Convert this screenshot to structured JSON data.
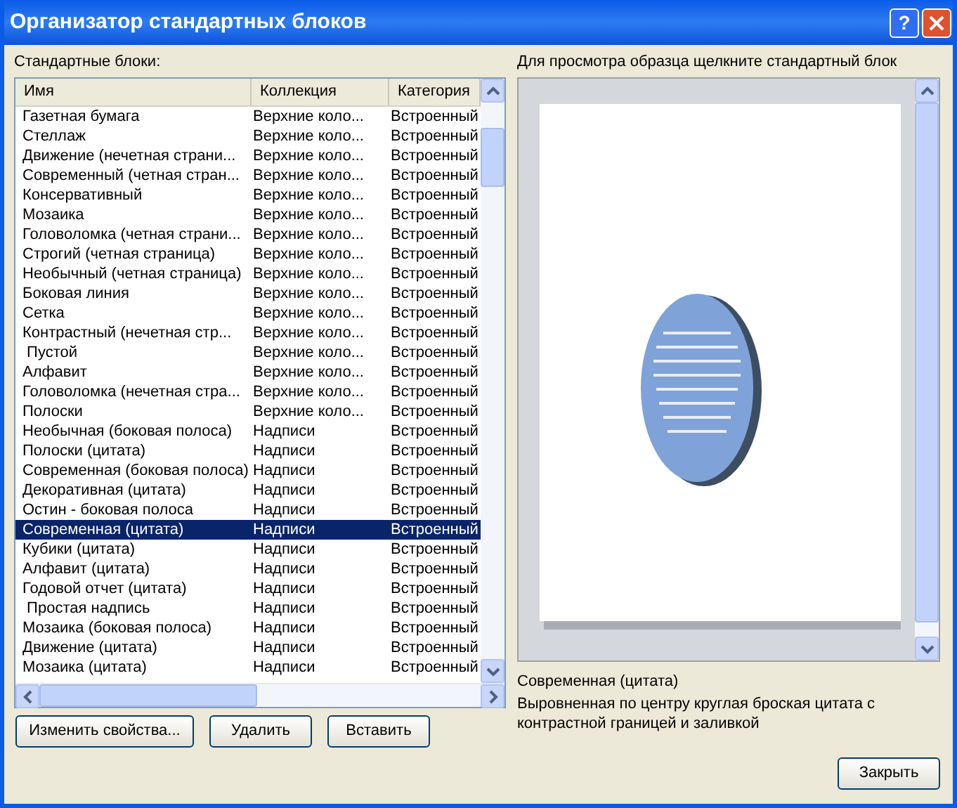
{
  "window": {
    "title": "Организатор стандартных блоков",
    "help_button": "?"
  },
  "list_label": "Стандартные блоки:",
  "table": {
    "columns": [
      "Имя",
      "Коллекция",
      "Категория"
    ],
    "rows": [
      {
        "cells": [
          "Газетная бумага",
          "Верхние коло...",
          "Встроенный"
        ],
        "selected": false
      },
      {
        "cells": [
          "Стеллаж",
          "Верхние коло...",
          "Встроенный"
        ],
        "selected": false
      },
      {
        "cells": [
          "Движение (нечетная страни...",
          "Верхние коло...",
          "Встроенный"
        ],
        "selected": false
      },
      {
        "cells": [
          "Современный (четная стран...",
          "Верхние коло...",
          "Встроенный"
        ],
        "selected": false
      },
      {
        "cells": [
          "Консервативный",
          "Верхние коло...",
          "Встроенный"
        ],
        "selected": false
      },
      {
        "cells": [
          "Мозаика",
          "Верхние коло...",
          "Встроенный"
        ],
        "selected": false
      },
      {
        "cells": [
          "Головоломка (четная страни...",
          "Верхние коло...",
          "Встроенный"
        ],
        "selected": false
      },
      {
        "cells": [
          "Строгий (четная страница)",
          "Верхние коло...",
          "Встроенный"
        ],
        "selected": false
      },
      {
        "cells": [
          "Необычный (четная страница)",
          "Верхние коло...",
          "Встроенный"
        ],
        "selected": false
      },
      {
        "cells": [
          "Боковая линия",
          "Верхние коло...",
          "Встроенный"
        ],
        "selected": false
      },
      {
        "cells": [
          "Сетка",
          "Верхние коло...",
          "Встроенный"
        ],
        "selected": false
      },
      {
        "cells": [
          "Контрастный (нечетная стр...",
          "Верхние коло...",
          "Встроенный"
        ],
        "selected": false
      },
      {
        "cells": [
          " Пустой",
          "Верхние коло...",
          "Встроенный"
        ],
        "selected": false
      },
      {
        "cells": [
          "Алфавит",
          "Верхние коло...",
          "Встроенный"
        ],
        "selected": false
      },
      {
        "cells": [
          "Головоломка (нечетная стра...",
          "Верхние коло...",
          "Встроенный"
        ],
        "selected": false
      },
      {
        "cells": [
          "Полоски",
          "Верхние коло...",
          "Встроенный"
        ],
        "selected": false
      },
      {
        "cells": [
          "Необычная (боковая полоса)",
          "Надписи",
          "Встроенный"
        ],
        "selected": false
      },
      {
        "cells": [
          "Полоски (цитата)",
          "Надписи",
          "Встроенный"
        ],
        "selected": false
      },
      {
        "cells": [
          "Современная (боковая полоса)",
          "Надписи",
          "Встроенный"
        ],
        "selected": false
      },
      {
        "cells": [
          "Декоративная (цитата)",
          "Надписи",
          "Встроенный"
        ],
        "selected": false
      },
      {
        "cells": [
          "Остин - боковая полоса",
          "Надписи",
          "Встроенный"
        ],
        "selected": false
      },
      {
        "cells": [
          "Современная (цитата)",
          "Надписи",
          "Встроенный"
        ],
        "selected": true
      },
      {
        "cells": [
          "Кубики (цитата)",
          "Надписи",
          "Встроенный"
        ],
        "selected": false
      },
      {
        "cells": [
          "Алфавит (цитата)",
          "Надписи",
          "Встроенный"
        ],
        "selected": false
      },
      {
        "cells": [
          "Годовой отчет (цитата)",
          "Надписи",
          "Встроенный"
        ],
        "selected": false
      },
      {
        "cells": [
          " Простая надпись",
          "Надписи",
          "Встроенный"
        ],
        "selected": false
      },
      {
        "cells": [
          "Мозаика (боковая полоса)",
          "Надписи",
          "Встроенный"
        ],
        "selected": false
      },
      {
        "cells": [
          "Движение (цитата)",
          "Надписи",
          "Встроенный"
        ],
        "selected": false
      },
      {
        "cells": [
          "Мозаика (цитата)",
          "Надписи",
          "Встроенный"
        ],
        "selected": false
      }
    ]
  },
  "buttons": [
    "Изменить свойства...",
    "Удалить",
    "Вставить"
  ],
  "preview": {
    "label": "Для просмотра образца щелкните стандартный блок",
    "caption": "Современная (цитата)",
    "description": "Выровненная по центру круглая броская цитата с контрастной границей и заливкой"
  },
  "close_button": "Закрыть"
}
